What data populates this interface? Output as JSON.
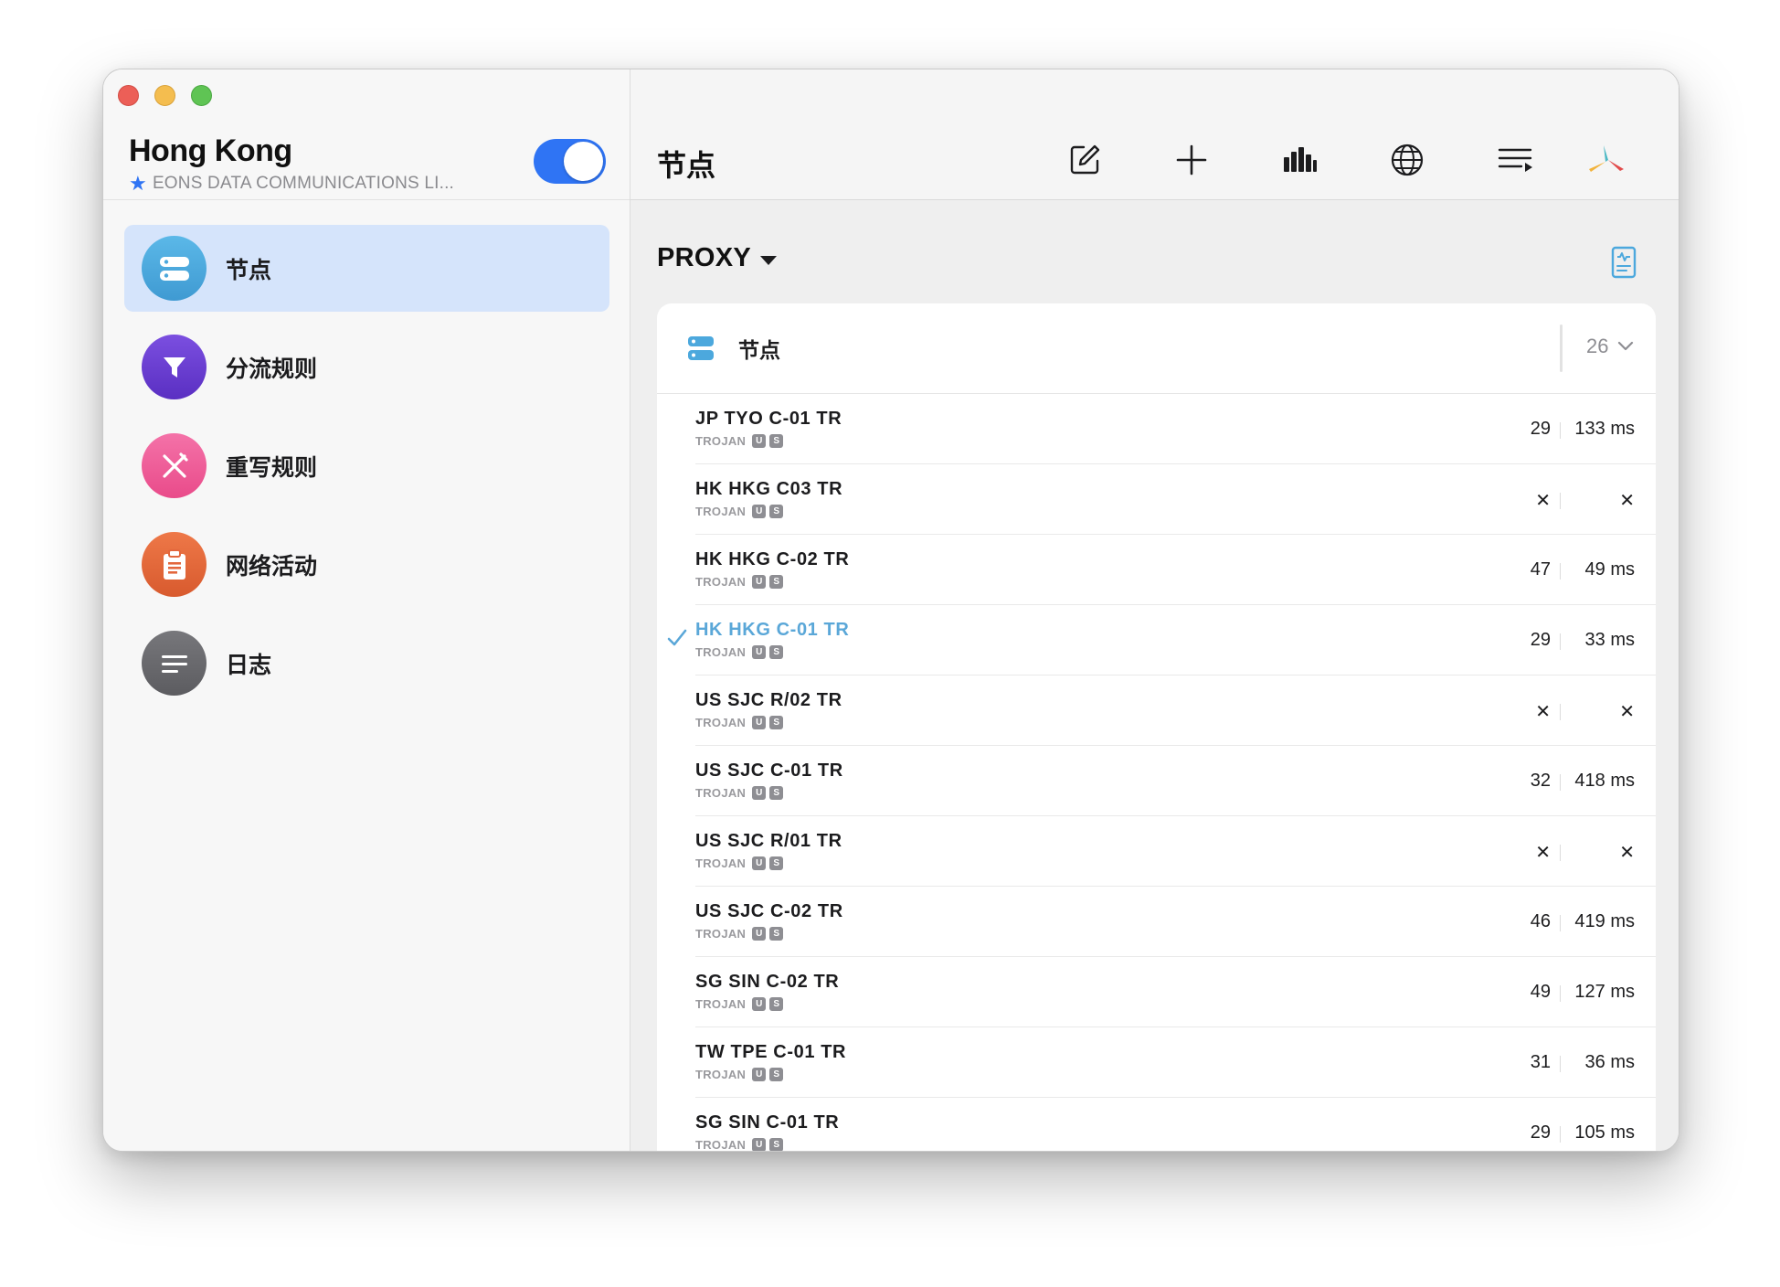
{
  "sidebar": {
    "title": "Hong Kong",
    "subtitle": "EONS DATA COMMUNICATIONS LI...",
    "enabled": true,
    "items": [
      {
        "label": "节点",
        "icon": "server-icon",
        "color": "#4ca8dd",
        "active": true
      },
      {
        "label": "分流规则",
        "icon": "filter-icon",
        "color": "#6a3fd0",
        "active": false
      },
      {
        "label": "重写规则",
        "icon": "rewrite-icon",
        "color": "#ee5f98",
        "active": false
      },
      {
        "label": "网络活动",
        "icon": "clipboard-icon",
        "color": "#e3673d",
        "active": false
      },
      {
        "label": "日志",
        "icon": "log-icon",
        "color": "#6d6d71",
        "active": false
      }
    ]
  },
  "toolbar": {
    "title": "节点",
    "buttons": [
      "edit-icon",
      "add-icon",
      "chart-icon",
      "globe-icon",
      "list-icon",
      "app-logo-icon"
    ]
  },
  "group": {
    "name": "PROXY",
    "header_label": "节点",
    "count": "26"
  },
  "nodes": [
    {
      "name": "JP TYO C-01 TR",
      "protocol": "TROJAN",
      "tags": [
        "U",
        "S"
      ],
      "value1": "29",
      "value2": "133 ms",
      "selected": false
    },
    {
      "name": "HK HKG C03 TR",
      "protocol": "TROJAN",
      "tags": [
        "U",
        "S"
      ],
      "value1": "✕",
      "value2": "✕",
      "selected": false
    },
    {
      "name": "HK HKG C-02 TR",
      "protocol": "TROJAN",
      "tags": [
        "U",
        "S"
      ],
      "value1": "47",
      "value2": "49 ms",
      "selected": false
    },
    {
      "name": "HK HKG C-01 TR",
      "protocol": "TROJAN",
      "tags": [
        "U",
        "S"
      ],
      "value1": "29",
      "value2": "33 ms",
      "selected": true
    },
    {
      "name": "US SJC R/02 TR",
      "protocol": "TROJAN",
      "tags": [
        "U",
        "S"
      ],
      "value1": "✕",
      "value2": "✕",
      "selected": false
    },
    {
      "name": "US SJC C-01 TR",
      "protocol": "TROJAN",
      "tags": [
        "U",
        "S"
      ],
      "value1": "32",
      "value2": "418 ms",
      "selected": false
    },
    {
      "name": "US SJC R/01 TR",
      "protocol": "TROJAN",
      "tags": [
        "U",
        "S"
      ],
      "value1": "✕",
      "value2": "✕",
      "selected": false
    },
    {
      "name": "US SJC C-02 TR",
      "protocol": "TROJAN",
      "tags": [
        "U",
        "S"
      ],
      "value1": "46",
      "value2": "419 ms",
      "selected": false
    },
    {
      "name": "SG SIN C-02 TR",
      "protocol": "TROJAN",
      "tags": [
        "U",
        "S"
      ],
      "value1": "49",
      "value2": "127 ms",
      "selected": false
    },
    {
      "name": "TW TPE C-01 TR",
      "protocol": "TROJAN",
      "tags": [
        "U",
        "S"
      ],
      "value1": "31",
      "value2": "36 ms",
      "selected": false
    },
    {
      "name": "SG SIN C-01 TR",
      "protocol": "TROJAN",
      "tags": [
        "U",
        "S"
      ],
      "value1": "29",
      "value2": "105 ms",
      "selected": false
    }
  ],
  "colors": {
    "accent": "#2f74f4",
    "selected_text": "#5aa7d8",
    "active_nav_bg": "#d5e4fb"
  }
}
